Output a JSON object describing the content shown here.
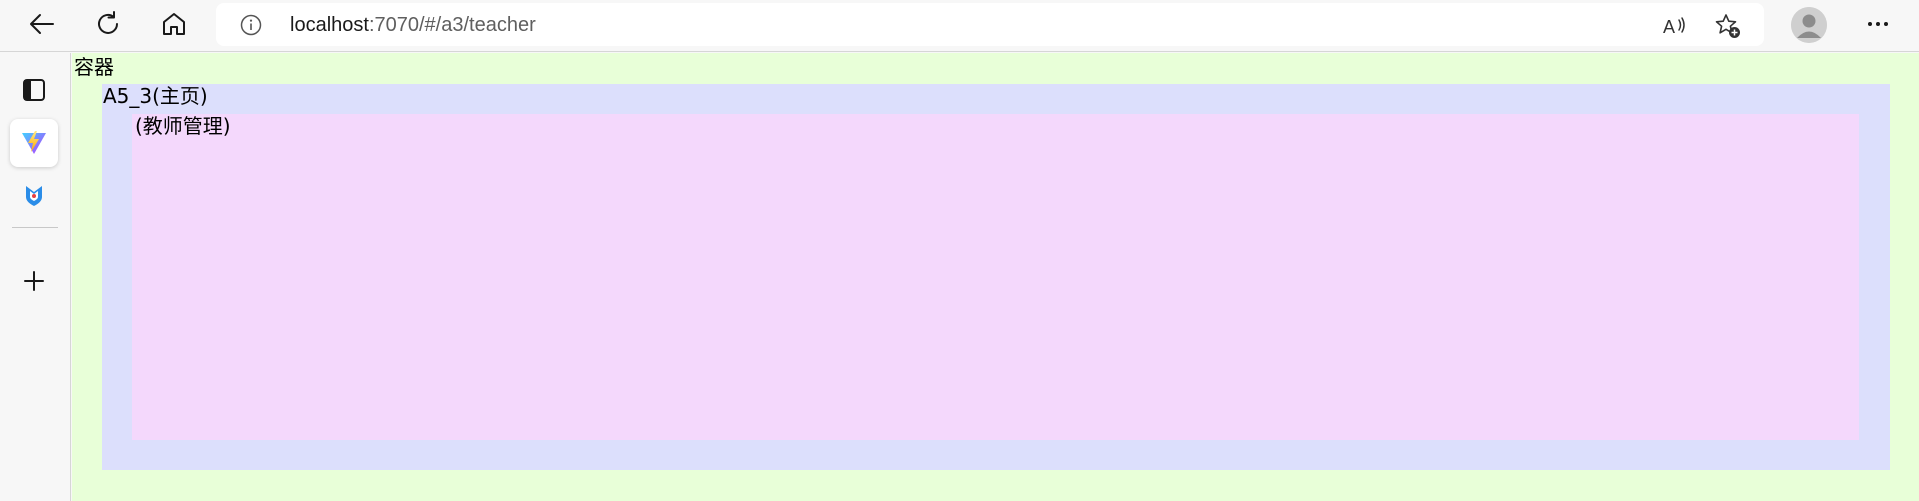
{
  "browser": {
    "url_host": "localhost",
    "url_rest": ":7070/#/a3/teacher",
    "toolbar_icons": [
      "back-arrow-icon",
      "refresh-icon",
      "home-icon",
      "info-icon",
      "read-aloud-icon",
      "add-favorite-icon",
      "profile-avatar",
      "more-options-icon"
    ],
    "sidebar_icons": [
      "tab-actions-icon",
      "vite-app-icon",
      "shield-extension-icon",
      "add-icon"
    ]
  },
  "page": {
    "container_label": "容器",
    "home_label": "A5_3(主页)",
    "teacher_label": "(教师管理)",
    "colors": {
      "container_bg": "#e8ffd8",
      "home_bg": "#dcdffc",
      "teacher_bg": "#f4d8fc"
    }
  }
}
